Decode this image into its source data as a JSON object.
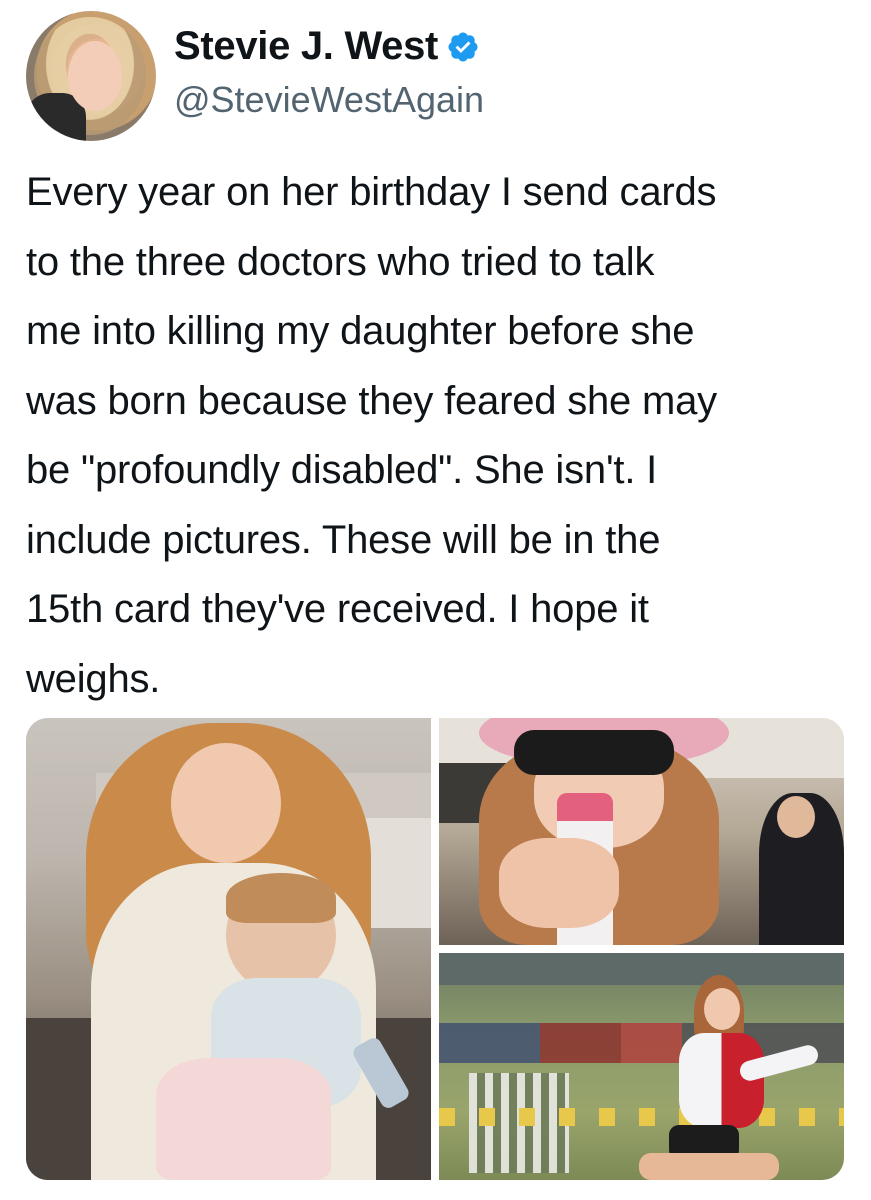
{
  "user": {
    "display_name": "Stevie J. West",
    "handle": "@StevieWestAgain",
    "verified": true,
    "verified_icon": "verified-badge-icon"
  },
  "tweet": {
    "text": "Every year on her birthday I send cards\nto the three doctors who tried to talk\nme into killing my daughter before she\nwas born because they feared she may\nbe \"profoundly disabled\". She isn't. I\ninclude pictures. These will be in the\n15th card they've received. I hope it\nweighs."
  },
  "colors": {
    "verified_blue": "#1d9bf0",
    "handle_gray": "#536471",
    "text": "#0f1419"
  },
  "media": {
    "photo_count": 3
  }
}
